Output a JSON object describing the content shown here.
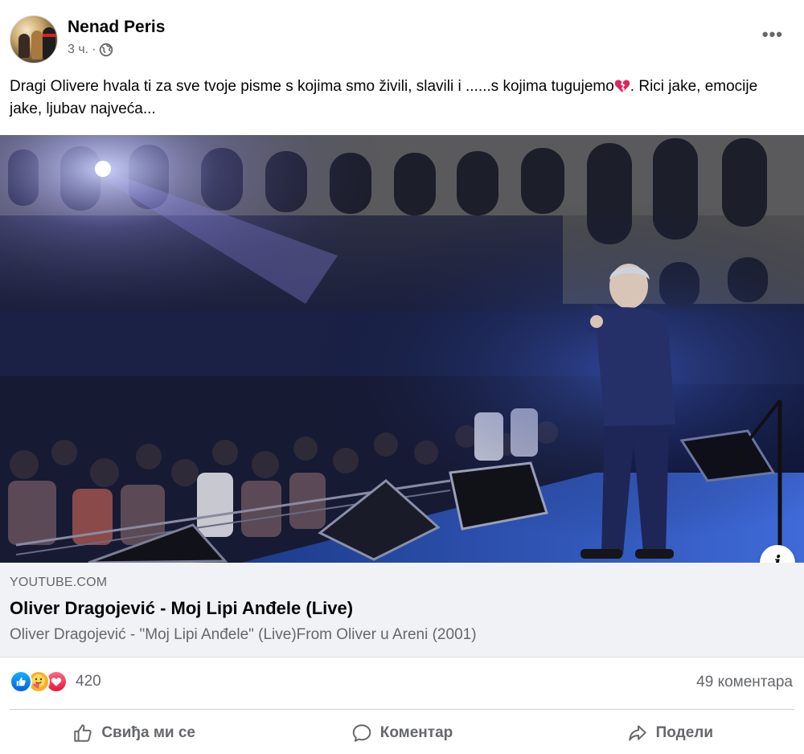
{
  "post": {
    "author": "Nenad Peris",
    "time": "3 ч.",
    "separator": "·",
    "privacy_icon": "globe-icon",
    "more_label": "•••",
    "text_main": "Dragi Olivere hvala ti za sve tvoje pisme s kojima smo živili, slavili i ......s kojima tugujemo",
    "text_after_emoji": ". Rici jake, emocije jake, ljubav najveća..."
  },
  "link": {
    "domain": "YOUTUBE.COM",
    "title": "Oliver Dragojević - Moj Lipi Anđele (Live)",
    "description": "Oliver Dragojević - \"Moj Lipi Anđele\" (Live)From Oliver u Areni (2001)",
    "info_label": "i"
  },
  "stats": {
    "reaction_icons": [
      "like-icon",
      "care-icon",
      "love-icon"
    ],
    "reaction_count": "420",
    "comments": "49 коментара"
  },
  "actions": {
    "like": "Свиђа ми се",
    "comment": "Коментар",
    "share": "Подели"
  },
  "colors": {
    "secondary_text": "#65676b",
    "link_background": "#f0f2f5",
    "like_blue": "#1877f2",
    "love_red": "#e61739",
    "care_yellow": "#f7b125"
  }
}
